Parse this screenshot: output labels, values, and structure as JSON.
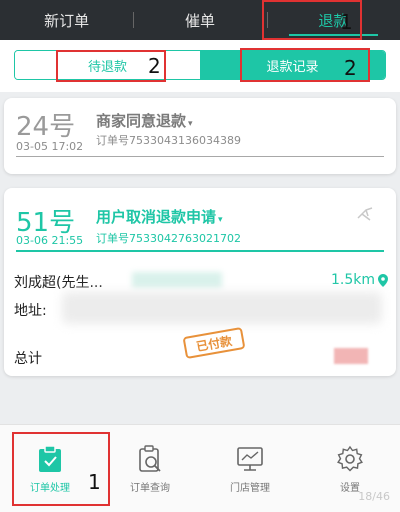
{
  "top_tabs": [
    {
      "label": "新订单",
      "active": false
    },
    {
      "label": "催单",
      "active": false
    },
    {
      "label": "退款",
      "active": true
    }
  ],
  "segment": {
    "pending_label": "待退款",
    "records_label": "退款记录"
  },
  "annotations": {
    "tab_refund": "1",
    "seg_pending": "2",
    "seg_records": "2",
    "nav_orders": "1"
  },
  "orders": [
    {
      "number": "24号",
      "time": "03-05 17:02",
      "status": "商家同意退款",
      "order_no": "订单号7533043136034389"
    },
    {
      "number": "51号",
      "time": "03-06 21:55",
      "status": "用户取消退款申请",
      "order_no": "订单号7533042763021702",
      "customer": "刘成超(先生...",
      "distance": "1.5km",
      "address_label": "地址:",
      "total_label": "总计",
      "paid_stamp": "已付款"
    }
  ],
  "bottom_nav": [
    {
      "label": "订单处理",
      "icon": "clipboard-check-icon",
      "active": true
    },
    {
      "label": "订单查询",
      "icon": "order-search-icon",
      "active": false
    },
    {
      "label": "门店管理",
      "icon": "monitor-icon",
      "active": false
    },
    {
      "label": "设置",
      "icon": "gear-icon",
      "active": false
    }
  ],
  "page_counter": "18/46",
  "colors": {
    "accent": "#1ec6a6",
    "topbar_bg": "#2b2f33",
    "annotation_red": "#e03232",
    "stamp_orange": "#e8913a"
  }
}
